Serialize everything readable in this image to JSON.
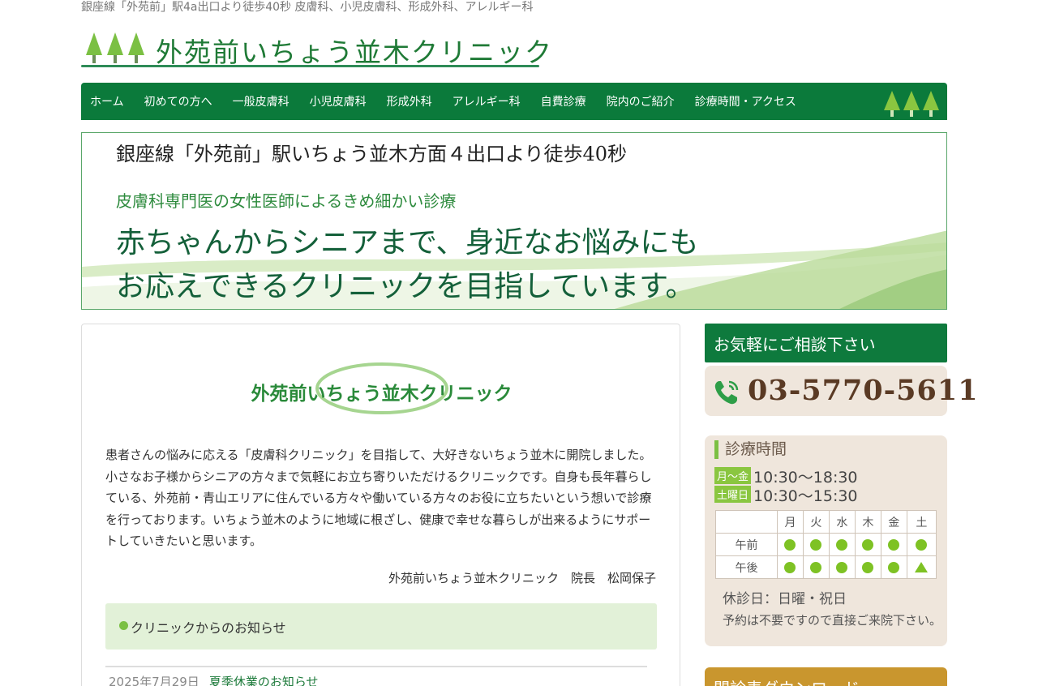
{
  "header": {
    "tagline": "銀座線「外苑前」駅4a出口より徒歩40秒 皮膚科、小児皮膚科、形成外科、アレルギー科",
    "logo_text": "外苑前いちょう並木クリニック"
  },
  "nav": {
    "items": [
      "ホーム",
      "初めての方へ",
      "一般皮膚科",
      "小児皮膚科",
      "形成外科",
      "アレルギー科",
      "自費診療",
      "院内のご紹介",
      "診療時間・アクセス"
    ]
  },
  "hero": {
    "line1": "銀座線「外苑前」駅いちょう並木方面４出口より徒歩40秒",
    "line2": "皮膚科専門医の女性医師によるきめ細かい診療",
    "line3": "赤ちゃんからシニアまで、身近なお悩みにも",
    "line4": "お応えできるクリニックを目指しています。"
  },
  "main": {
    "title": "外苑前いちょう並木クリニック",
    "intro": "患者さんの悩みに応える「皮膚科クリニック」を目指して、大好きないちょう並木に開院しました。小さなお子様からシニアの方々まで気軽にお立ち寄りいただけるクリニックです。自身も長年暮らしている、外苑前・青山エリアに住んでいる方々や働いている方々のお役に立ちたいという想いで診療を行っております。いちょう並木のように地域に根ざし、健康で幸せな暮らしが出来るようにサポートしていきたいと思います。",
    "signature": "外苑前いちょう並木クリニック　院長　松岡保子",
    "news_heading": "クリニックからのお知らせ",
    "news": [
      {
        "date": "2025年7月29日",
        "title": "夏季休業のお知らせ"
      }
    ]
  },
  "sidebar": {
    "consult_heading": "お気軽にご相談下さい",
    "phone": "03-5770-5611",
    "hours_title": "診療時間",
    "weekday_tag": "月〜金",
    "weekday_time": "10:30〜18:30",
    "sat_tag": "土曜日",
    "sat_time": "10:30〜15:30",
    "days": [
      "月",
      "火",
      "水",
      "木",
      "金",
      "土"
    ],
    "am_label": "午前",
    "pm_label": "午後",
    "closed": "休診日：日曜・祝日",
    "note": "予約は不要ですので直接ご来院下さい。",
    "download_heading": "問診表ダウンロード"
  },
  "colors": {
    "brand_green": "#0b7a3b",
    "accent_lime": "#7ec224",
    "sidebar_beige": "#efe6dc",
    "download_gold": "#c9962e"
  }
}
